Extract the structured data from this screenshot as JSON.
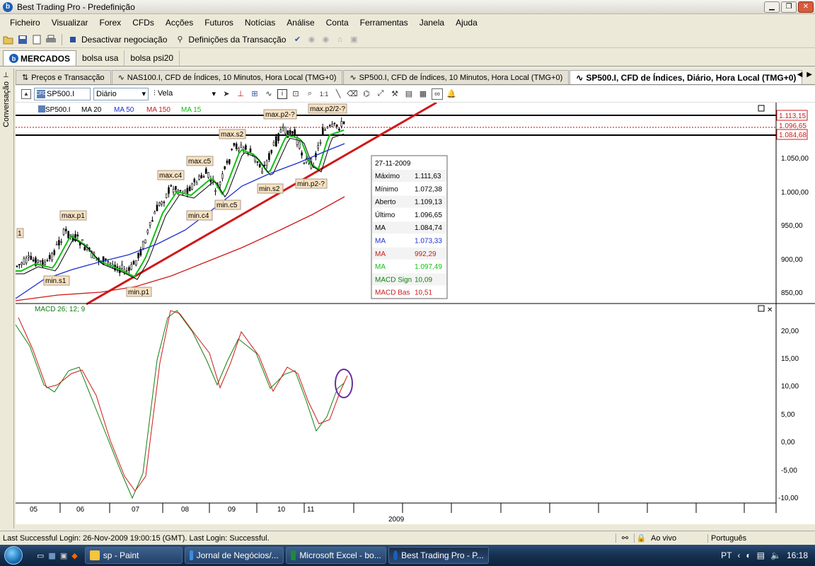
{
  "window": {
    "title": "Best Trading Pro - Predefinição",
    "app_logo": "b"
  },
  "window_buttons": {
    "minimize": "▁",
    "restore": "❐",
    "close": "✕"
  },
  "menu": [
    "Ficheiro",
    "Visualizar",
    "Forex",
    "CFDs",
    "Acções",
    "Futuros",
    "Notícias",
    "Análise",
    "Conta",
    "Ferramentas",
    "Janela",
    "Ajuda"
  ],
  "toolbar": {
    "deactivate": "Desactivar negociação",
    "settings": "Definições da Transacção"
  },
  "workspace_tabs": [
    "MERCADOS",
    "bolsa usa",
    "bolsa psi20"
  ],
  "sidebar": {
    "label": "Conversação"
  },
  "doc_tabs": [
    "Preços e Transacção",
    "NAS100.I, CFD de Índices, 10 Minutos, Hora Local (TMG+0)",
    "SP500.I, CFD de Índices, 10 Minutos, Hora Local (TMG+0)",
    "SP500.I, CFD de Índices, Diário, Hora Local (TMG+0)"
  ],
  "chart_toolbar": {
    "symbol": "SP500.I",
    "period": "Diário",
    "style": "Vela"
  },
  "legend": [
    {
      "label": "SP500.I",
      "color": "#000000"
    },
    {
      "label": "MA 20",
      "color": "#000000"
    },
    {
      "label": "MA 50",
      "color": "#1a2fd0"
    },
    {
      "label": "MA 150",
      "color": "#d01818"
    },
    {
      "label": "MA 15",
      "color": "#10c010"
    }
  ],
  "price_labels": [
    "1.113,15",
    "1.096,65",
    "1.084,68"
  ],
  "y_ticks": [
    "1.050,00",
    "1.000,00",
    "950,00",
    "900,00",
    "850,00"
  ],
  "annotations": [
    "max.p1",
    "max.c4",
    "max.c5",
    "max.s2",
    "max.p2-?",
    "max.p2/2-?",
    "min.s1",
    "min.p1",
    "min.c4",
    "min.c5",
    "min.s2",
    "min.p2-?",
    "1"
  ],
  "info_box": {
    "date": "27-11-2009",
    "rows": [
      {
        "label": "Máximo",
        "value": "1.111,63",
        "color": "#000000"
      },
      {
        "label": "Mínimo",
        "value": "1.072,38",
        "color": "#000000"
      },
      {
        "label": "Aberto",
        "value": "1.109,13",
        "color": "#000000"
      },
      {
        "label": "Último",
        "value": "1.096,65",
        "color": "#000000"
      },
      {
        "label": "MA",
        "value": "1.084,74",
        "color": "#000000"
      },
      {
        "label": "MA",
        "value": "1.073,33",
        "color": "#1a2fd0"
      },
      {
        "label": "MA",
        "value": "992,29",
        "color": "#d01818"
      },
      {
        "label": "MA",
        "value": "1.097,49",
        "color": "#10c010"
      },
      {
        "label": "MACD Sign",
        "value": "10,09",
        "color": "#108010"
      },
      {
        "label": "MACD Bas",
        "value": "10,51",
        "color": "#d01818"
      }
    ]
  },
  "macd": {
    "title": "MACD 26; 12; 9",
    "ticks": [
      "20,00",
      "15,00",
      "10,00",
      "5,00",
      "0,00",
      "-5,00",
      "-10,00"
    ]
  },
  "x_axis": {
    "months": [
      "05",
      "06",
      "07",
      "08",
      "09",
      "10",
      "11"
    ],
    "year": "2009"
  },
  "status": {
    "login": "Last Successful Login: 26-Nov-2009 19:00:15 (GMT). Last Login: Successful.",
    "live": "Ao vivo",
    "language": "Português"
  },
  "taskbar": {
    "tasks": [
      "sp - Paint",
      "Jornal de Negócios/...",
      "Microsoft Excel - bo...",
      "Best Trading Pro - P..."
    ],
    "lang": "PT",
    "clock": "16:18"
  }
}
